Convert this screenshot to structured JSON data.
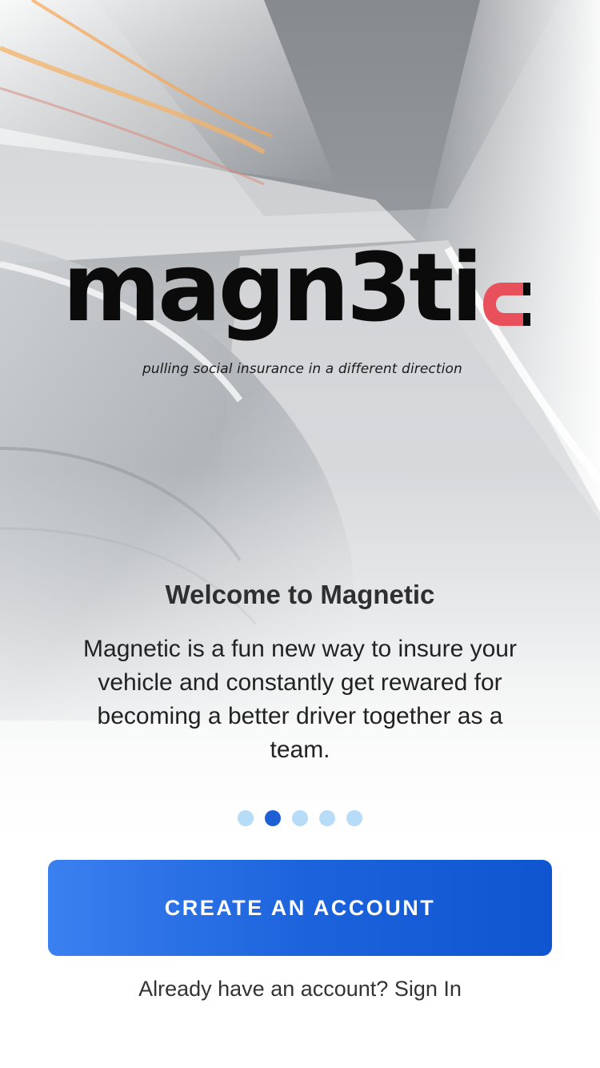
{
  "brand": {
    "logo_text": "magn3ti",
    "tagline": "pulling social insurance in a different direction",
    "accent_color": "#e8505b"
  },
  "welcome": {
    "title": "Welcome to Magnetic",
    "body": "Magnetic is a fun new way to insure your vehicle and constantly get rewared for becoming a better driver together as a team."
  },
  "pager": {
    "count": 5,
    "active_index": 1
  },
  "actions": {
    "create_account_label": "CREATE AN ACCOUNT",
    "signin_prompt": "Already have an account?",
    "signin_label": "Sign In"
  },
  "colors": {
    "primary": "#1d63dc",
    "dot_inactive": "#b6dcf7",
    "dot_active": "#1f5fd6"
  }
}
